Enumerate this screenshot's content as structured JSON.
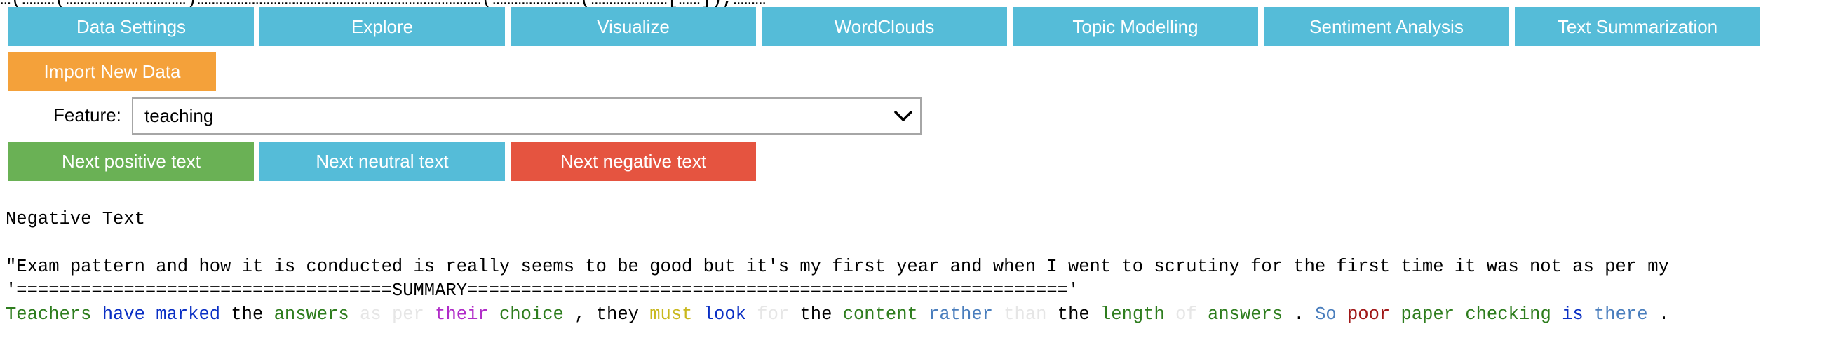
{
  "clipped_top_line": "…(………(……………………………)……………………………………………………………………(……………………(…………………[……]),………",
  "tabs": [
    {
      "label": "Data Settings"
    },
    {
      "label": "Explore"
    },
    {
      "label": "Visualize"
    },
    {
      "label": "WordClouds"
    },
    {
      "label": "Topic Modelling"
    },
    {
      "label": "Sentiment Analysis"
    },
    {
      "label": "Text Summarization"
    }
  ],
  "import_button": "Import New Data",
  "feature": {
    "label": "Feature:",
    "selected": "teaching"
  },
  "nav_buttons": {
    "positive": "Next positive text",
    "neutral": "Next neutral text",
    "negative": "Next negative text"
  },
  "output": {
    "heading": "Negative Text",
    "original_text": "\"Exam pattern and how it is conducted is really seems to be good but it's my first year and when I went to scrutiny for the first time it was not as per my",
    "summary_line": "'===================================SUMMARY========================================================'",
    "summary_words": [
      {
        "text": "Teachers",
        "color": "#2e7d1e"
      },
      {
        "text": "have",
        "color": "#0a2fc4"
      },
      {
        "text": "marked",
        "color": "#0a2fc4"
      },
      {
        "text": "the",
        "color": "#000000"
      },
      {
        "text": "answers",
        "color": "#2e7d1e"
      },
      {
        "text": "as",
        "color": "#e6e6e6"
      },
      {
        "text": "per",
        "color": "#e6e6e6"
      },
      {
        "text": "their",
        "color": "#b02bc8"
      },
      {
        "text": "choice",
        "color": "#2e7d1e"
      },
      {
        "text": ",",
        "color": "#000000"
      },
      {
        "text": "they",
        "color": "#000000"
      },
      {
        "text": "must",
        "color": "#c9b81e"
      },
      {
        "text": "look",
        "color": "#0a2fc4"
      },
      {
        "text": "for",
        "color": "#e6e6e6"
      },
      {
        "text": "the",
        "color": "#000000"
      },
      {
        "text": "content",
        "color": "#2e7d1e"
      },
      {
        "text": "rather",
        "color": "#4a7ebd"
      },
      {
        "text": "than",
        "color": "#e6e6e6"
      },
      {
        "text": "the",
        "color": "#000000"
      },
      {
        "text": "length",
        "color": "#2e7d1e"
      },
      {
        "text": "of",
        "color": "#e6e6e6"
      },
      {
        "text": "answers",
        "color": "#2e7d1e"
      },
      {
        "text": ".",
        "color": "#000000"
      },
      {
        "text": "So",
        "color": "#4a7ebd"
      },
      {
        "text": "poor",
        "color": "#a01818"
      },
      {
        "text": "paper",
        "color": "#2e7d1e"
      },
      {
        "text": "checking",
        "color": "#2e7d1e"
      },
      {
        "text": "is",
        "color": "#0a2fc4"
      },
      {
        "text": "there",
        "color": "#4a7ebd"
      },
      {
        "text": ".",
        "color": "#000000"
      }
    ]
  },
  "colors": {
    "tab": "#55bcd8",
    "import": "#f4a13a",
    "positive": "#6ab155",
    "neutral": "#55bcd8",
    "negative": "#e55440"
  }
}
